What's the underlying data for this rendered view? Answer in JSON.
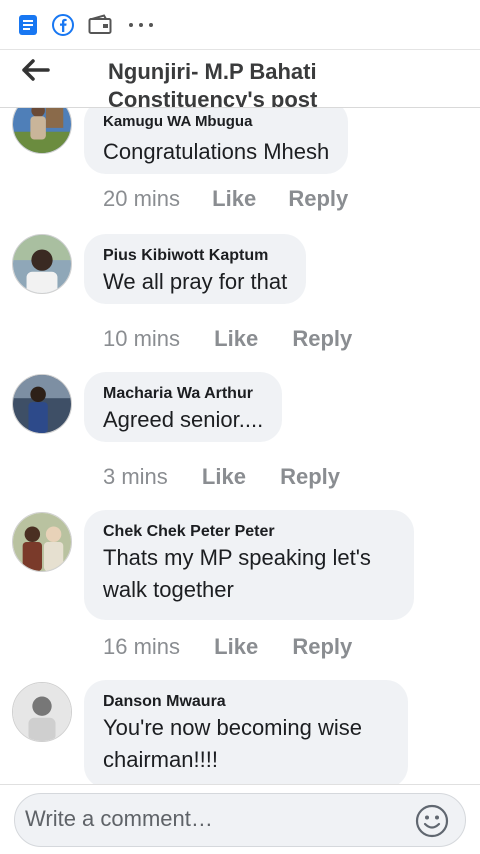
{
  "header": {
    "title": "Ngunjiri- M.P Bahati Constituency's post"
  },
  "statusbar": {
    "icons": [
      "notes-app-icon",
      "facebook-icon",
      "wallet-icon",
      "more-dots-icon"
    ]
  },
  "comments": [
    {
      "name": "Kamugu WA Mbugua",
      "text": "Congratulations Mhesh",
      "time": "20 mins",
      "like": "Like",
      "reply": "Reply"
    },
    {
      "name": "Pius Kibiwott Kaptum",
      "text": "We all pray for that",
      "time": "10 mins",
      "like": "Like",
      "reply": "Reply"
    },
    {
      "name": "Macharia Wa Arthur",
      "text": "Agreed senior....",
      "time": "3 mins",
      "like": "Like",
      "reply": "Reply"
    },
    {
      "name": "Chek Chek Peter Peter",
      "text": "Thats my MP speaking let's walk together",
      "time": "16 mins",
      "like": "Like",
      "reply": "Reply"
    },
    {
      "name": "Danson Mwaura",
      "text": "You're now becoming wise chairman!!!!",
      "time": "",
      "like": "",
      "reply": ""
    }
  ],
  "composer": {
    "placeholder": "Write a comment…"
  },
  "colors": {
    "accent": "#1877f2",
    "bubble": "#f0f2f5",
    "meta": "#8a8d91"
  }
}
